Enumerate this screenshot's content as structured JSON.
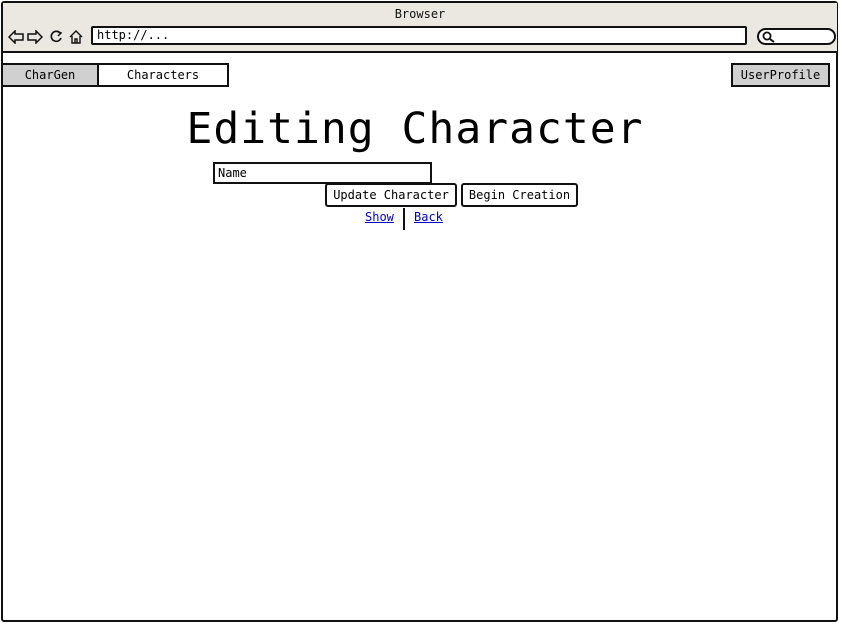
{
  "browser": {
    "title": "Browser",
    "url": "http://...",
    "icons": [
      "back-arrow-icon",
      "forward-arrow-icon",
      "reload-icon",
      "home-icon",
      "search-icon"
    ]
  },
  "tabs": {
    "app": "CharGen",
    "characters": "Characters",
    "user_profile": "UserProfile"
  },
  "main": {
    "heading": "Editing Character",
    "name_field": {
      "value": "Name",
      "placeholder": "Name"
    },
    "update_button": "Update Character",
    "begin_button": "Begin Creation",
    "links": {
      "show": "Show",
      "back": "Back"
    }
  }
}
